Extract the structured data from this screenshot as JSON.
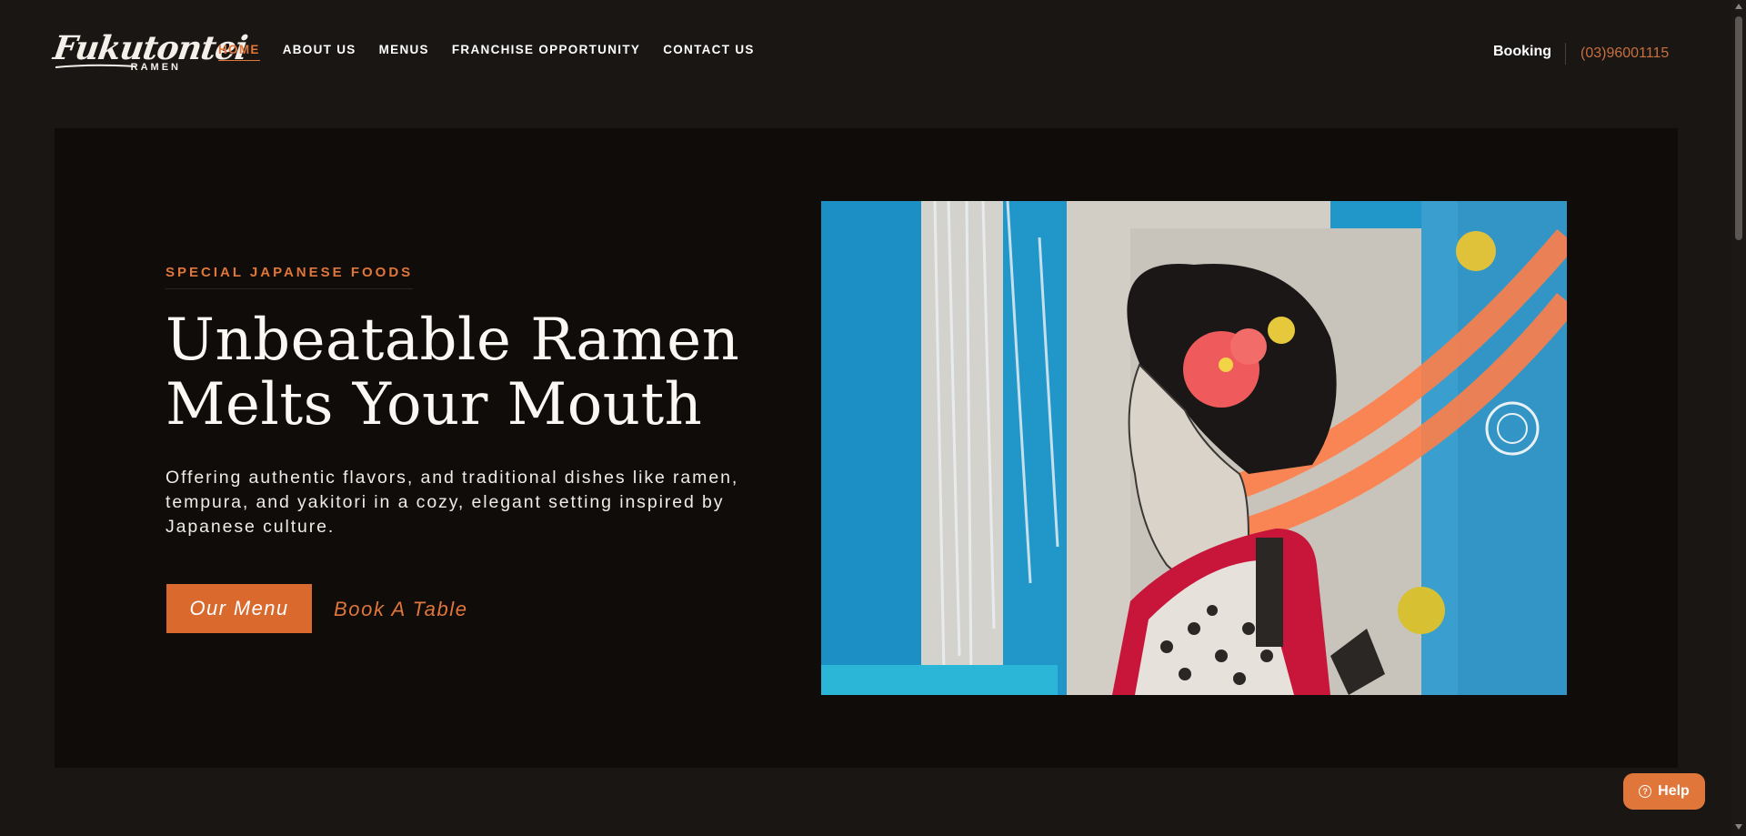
{
  "header": {
    "logo_text": "Fukutontei",
    "logo_sub": "RAMEN",
    "nav": [
      {
        "label": "HOME",
        "active": true
      },
      {
        "label": "ABOUT US"
      },
      {
        "label": "MENUS"
      },
      {
        "label": "FRANCHISE OPPORTUNITY"
      },
      {
        "label": "CONTACT US"
      }
    ],
    "booking_label": "Booking",
    "phone": "(03)96001115"
  },
  "hero": {
    "eyebrow": "SPECIAL JAPANESE FOODS",
    "headline_line1": "Unbeatable Ramen",
    "headline_line2": "Melts Your Mouth",
    "description": "Offering authentic flavors, and traditional dishes like ramen, tempura, and yakitori in a cozy, elegant setting inspired by Japanese culture.",
    "primary_button": "Our Menu",
    "secondary_link": "Book A Table",
    "image_subject": "artwork-japanese-woman-with-red-flower"
  },
  "help_button": {
    "label": "Help",
    "icon": "question-circle-icon"
  },
  "colors": {
    "accent": "#e0763a",
    "button_bg": "#d9692d",
    "page_bg": "#1a1614",
    "hero_bg": "#0f0c0a"
  }
}
